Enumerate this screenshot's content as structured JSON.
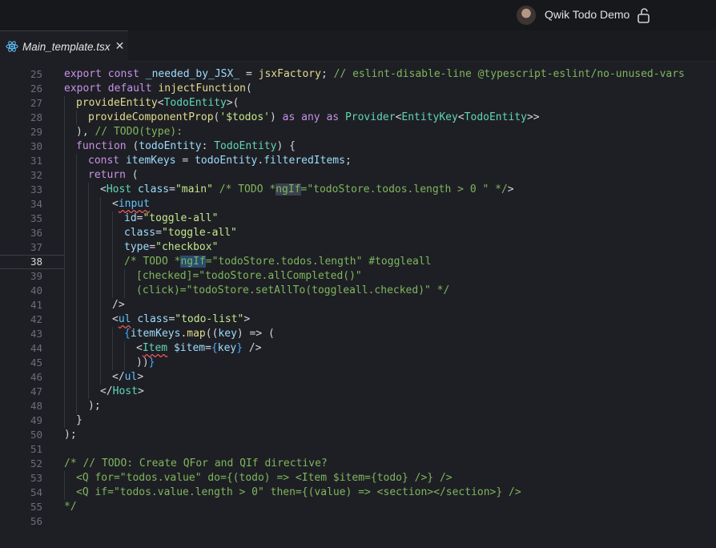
{
  "window": {
    "title": "Qwik Todo Demo"
  },
  "tab": {
    "label": "Main_template.tsx",
    "close_glyph": "✕"
  },
  "editor": {
    "active_line": 38,
    "lines": [
      {
        "n": 25,
        "indent": 0,
        "tokens": [
          [
            "keyword",
            "export"
          ],
          [
            "default",
            " "
          ],
          [
            "keyword",
            "const"
          ],
          [
            "default",
            " "
          ],
          [
            "ident",
            "_needed_by_JSX_"
          ],
          [
            "default",
            " = "
          ],
          [
            "fn",
            "jsxFactory"
          ],
          [
            "default",
            "; "
          ],
          [
            "comment",
            "// eslint-disable-line @typescript-eslint/no-unused-vars"
          ]
        ]
      },
      {
        "n": 26,
        "indent": 0,
        "tokens": [
          [
            "keyword",
            "export"
          ],
          [
            "default",
            " "
          ],
          [
            "keyword",
            "default"
          ],
          [
            "default",
            " "
          ],
          [
            "fn",
            "injectFunction"
          ],
          [
            "default",
            "("
          ]
        ]
      },
      {
        "n": 27,
        "indent": 1,
        "tokens": [
          [
            "fn",
            "provideEntity"
          ],
          [
            "default",
            "<"
          ],
          [
            "type",
            "TodoEntity"
          ],
          [
            "default",
            ">("
          ]
        ]
      },
      {
        "n": 28,
        "indent": 2,
        "tokens": [
          [
            "fn",
            "provideComponentProp"
          ],
          [
            "default",
            "("
          ],
          [
            "string",
            "'$todos'"
          ],
          [
            "default",
            ") "
          ],
          [
            "keyword",
            "as"
          ],
          [
            "default",
            " "
          ],
          [
            "keyword",
            "any"
          ],
          [
            "default",
            " "
          ],
          [
            "keyword",
            "as"
          ],
          [
            "default",
            " "
          ],
          [
            "type",
            "Provider"
          ],
          [
            "default",
            "<"
          ],
          [
            "type",
            "EntityKey"
          ],
          [
            "default",
            "<"
          ],
          [
            "type",
            "TodoEntity"
          ],
          [
            "default",
            ">>"
          ]
        ]
      },
      {
        "n": 29,
        "indent": 1,
        "tokens": [
          [
            "default",
            "), "
          ],
          [
            "comment",
            "// TODO(type):"
          ]
        ]
      },
      {
        "n": 30,
        "indent": 1,
        "tokens": [
          [
            "keyword",
            "function"
          ],
          [
            "default",
            " ("
          ],
          [
            "ident",
            "todoEntity"
          ],
          [
            "default",
            ": "
          ],
          [
            "type",
            "TodoEntity"
          ],
          [
            "default",
            ") {"
          ]
        ]
      },
      {
        "n": 31,
        "indent": 2,
        "tokens": [
          [
            "keyword",
            "const"
          ],
          [
            "default",
            " "
          ],
          [
            "ident",
            "itemKeys"
          ],
          [
            "default",
            " = "
          ],
          [
            "ident",
            "todoEntity"
          ],
          [
            "default",
            "."
          ],
          [
            "ident",
            "filteredItems"
          ],
          [
            "default",
            ";"
          ]
        ]
      },
      {
        "n": 32,
        "indent": 2,
        "tokens": [
          [
            "keyword",
            "return"
          ],
          [
            "default",
            " ("
          ]
        ]
      },
      {
        "n": 33,
        "indent": 3,
        "tokens": [
          [
            "default",
            "<"
          ],
          [
            "type",
            "Host"
          ],
          [
            "default",
            " "
          ],
          [
            "attr",
            "class"
          ],
          [
            "default",
            "="
          ],
          [
            "string",
            "\"main\""
          ],
          [
            "default",
            " "
          ],
          [
            "comment",
            "/* TODO *"
          ],
          [
            "comment-hl",
            "ngIf"
          ],
          [
            "comment",
            "=\"todoStore.todos.length > 0 \" */"
          ],
          [
            "default",
            ">"
          ]
        ]
      },
      {
        "n": 34,
        "indent": 4,
        "tokens": [
          [
            "default",
            "<"
          ],
          [
            "tag-warn",
            "input"
          ]
        ]
      },
      {
        "n": 35,
        "indent": 5,
        "tokens": [
          [
            "attr",
            "id"
          ],
          [
            "default",
            "="
          ],
          [
            "string",
            "\"toggle-all\""
          ]
        ]
      },
      {
        "n": 36,
        "indent": 5,
        "tokens": [
          [
            "attr",
            "class"
          ],
          [
            "default",
            "="
          ],
          [
            "string",
            "\"toggle-all\""
          ]
        ]
      },
      {
        "n": 37,
        "indent": 5,
        "tokens": [
          [
            "attr",
            "type"
          ],
          [
            "default",
            "="
          ],
          [
            "string",
            "\"checkbox\""
          ]
        ]
      },
      {
        "n": 38,
        "indent": 5,
        "tokens": [
          [
            "comment",
            "/* TODO *"
          ],
          [
            "comment-hl2",
            "ngIf"
          ],
          [
            "comment",
            "=\"todoStore.todos.length\" #toggleall"
          ]
        ]
      },
      {
        "n": 39,
        "indent": 6,
        "tokens": [
          [
            "comment",
            "[checked]=\"todoStore.allCompleted()\""
          ]
        ]
      },
      {
        "n": 40,
        "indent": 6,
        "tokens": [
          [
            "comment",
            "(click)=\"todoStore.setAllTo(toggleall.checked)\" */"
          ]
        ]
      },
      {
        "n": 41,
        "indent": 4,
        "tokens": [
          [
            "default",
            "/>"
          ]
        ]
      },
      {
        "n": 42,
        "indent": 4,
        "tokens": [
          [
            "default",
            "<"
          ],
          [
            "tag-warn",
            "ul"
          ],
          [
            "default",
            " "
          ],
          [
            "attr",
            "class"
          ],
          [
            "default",
            "="
          ],
          [
            "string",
            "\"todo-list\""
          ],
          [
            "default",
            ">"
          ]
        ]
      },
      {
        "n": 43,
        "indent": 5,
        "tokens": [
          [
            "brace",
            "{"
          ],
          [
            "ident",
            "itemKeys"
          ],
          [
            "default",
            "."
          ],
          [
            "fn",
            "map"
          ],
          [
            "default",
            "(("
          ],
          [
            "ident",
            "key"
          ],
          [
            "default",
            ") => ("
          ]
        ]
      },
      {
        "n": 44,
        "indent": 6,
        "tokens": [
          [
            "default",
            "<"
          ],
          [
            "type-warn",
            "Item"
          ],
          [
            "default",
            " "
          ],
          [
            "attr",
            "$item"
          ],
          [
            "default",
            "="
          ],
          [
            "brace",
            "{"
          ],
          [
            "ident",
            "key"
          ],
          [
            "brace",
            "}"
          ],
          [
            "default",
            " />"
          ]
        ]
      },
      {
        "n": 45,
        "indent": 6,
        "tokens": [
          [
            "default",
            "))"
          ],
          [
            "brace",
            "}"
          ]
        ]
      },
      {
        "n": 46,
        "indent": 4,
        "tokens": [
          [
            "default",
            "</"
          ],
          [
            "tag",
            "ul"
          ],
          [
            "default",
            ">"
          ]
        ]
      },
      {
        "n": 47,
        "indent": 3,
        "tokens": [
          [
            "default",
            "</"
          ],
          [
            "type",
            "Host"
          ],
          [
            "default",
            ">"
          ]
        ]
      },
      {
        "n": 48,
        "indent": 2,
        "tokens": [
          [
            "default",
            ");"
          ]
        ]
      },
      {
        "n": 49,
        "indent": 1,
        "tokens": [
          [
            "default",
            "}"
          ]
        ]
      },
      {
        "n": 50,
        "indent": 0,
        "tokens": [
          [
            "default",
            ");"
          ]
        ]
      },
      {
        "n": 51,
        "indent": 0,
        "tokens": []
      },
      {
        "n": 52,
        "indent": 0,
        "tokens": [
          [
            "comment",
            "/* // TODO: Create QFor and QIf directive?"
          ]
        ]
      },
      {
        "n": 53,
        "indent": 1,
        "tokens": [
          [
            "comment",
            "<Q for=\"todos.value\" do={(todo) => <Item $item={todo} />} />"
          ]
        ]
      },
      {
        "n": 54,
        "indent": 1,
        "tokens": [
          [
            "comment",
            "<Q if=\"todos.value.length > 0\" then={(value) => <section></section>} />"
          ]
        ]
      },
      {
        "n": 55,
        "indent": 0,
        "tokens": [
          [
            "comment",
            "*/"
          ]
        ]
      },
      {
        "n": 56,
        "indent": 0,
        "tokens": []
      }
    ]
  },
  "colors": {
    "background": "#1e1f24",
    "keyword": "#c792ea",
    "function": "#e3db8f",
    "type": "#5fd7b7",
    "string": "#c3e88d",
    "comment": "#7fb65e"
  },
  "icons": {
    "avatar": "user-avatar",
    "lock": "lock-open-icon",
    "file": "react-file-icon"
  }
}
